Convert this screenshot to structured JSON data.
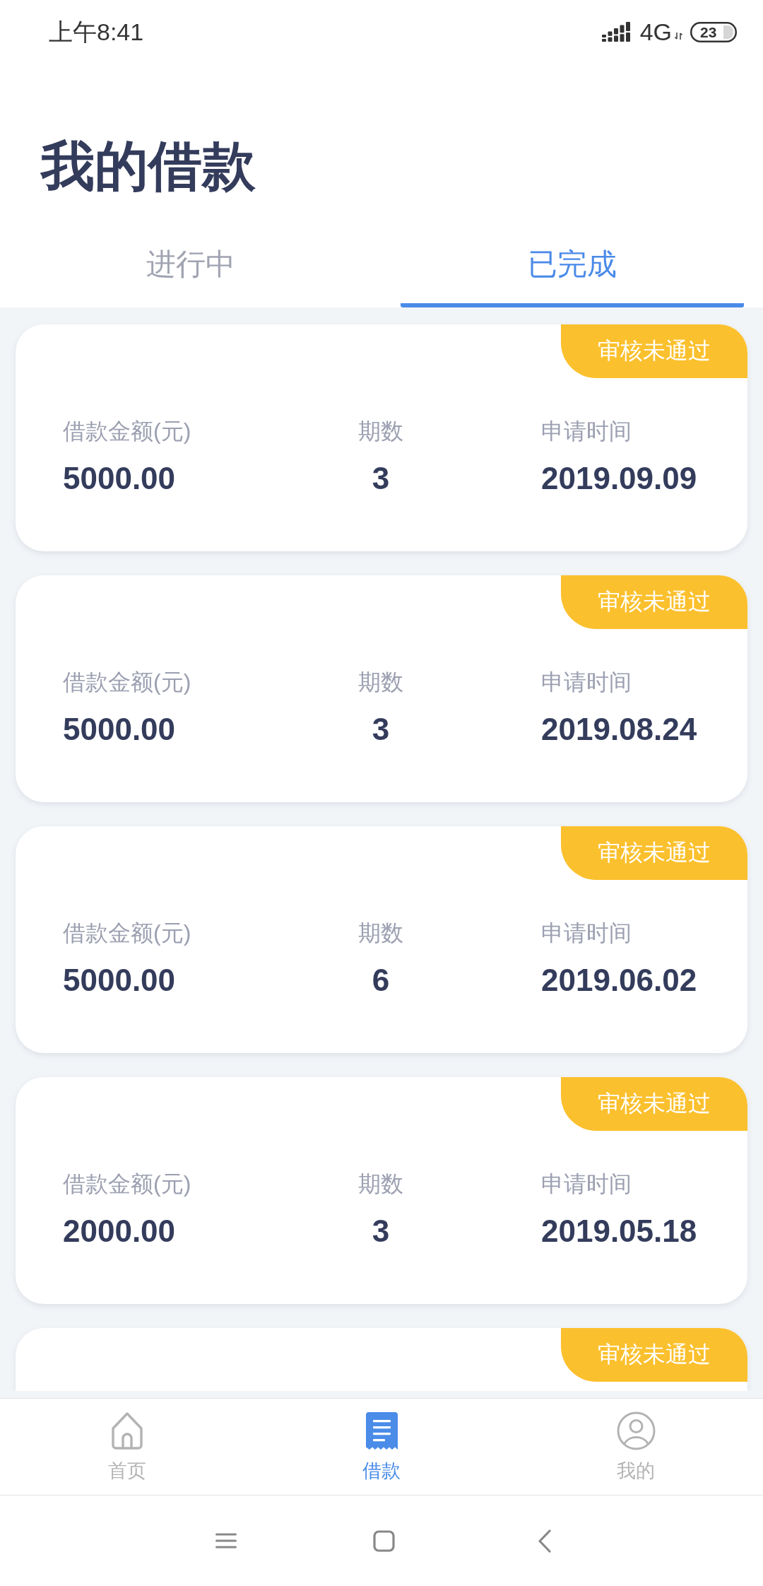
{
  "status_bar": {
    "time": "上午8:41",
    "network": "4G",
    "battery": "23"
  },
  "header": {
    "title": "我的借款"
  },
  "tabs": [
    {
      "label": "进行中",
      "selected": false
    },
    {
      "label": "已完成",
      "selected": true
    }
  ],
  "loans": [
    {
      "status": "审核未通过",
      "fields": [
        {
          "label": "借款金额(元)",
          "value": "5000.00"
        },
        {
          "label": "期数",
          "value": "3"
        },
        {
          "label": "申请时间",
          "value": "2019.09.09"
        }
      ]
    },
    {
      "status": "审核未通过",
      "fields": [
        {
          "label": "借款金额(元)",
          "value": "5000.00"
        },
        {
          "label": "期数",
          "value": "3"
        },
        {
          "label": "申请时间",
          "value": "2019.08.24"
        }
      ]
    },
    {
      "status": "审核未通过",
      "fields": [
        {
          "label": "借款金额(元)",
          "value": "5000.00"
        },
        {
          "label": "期数",
          "value": "6"
        },
        {
          "label": "申请时间",
          "value": "2019.06.02"
        }
      ]
    },
    {
      "status": "审核未通过",
      "fields": [
        {
          "label": "借款金额(元)",
          "value": "2000.00"
        },
        {
          "label": "期数",
          "value": "3"
        },
        {
          "label": "申请时间",
          "value": "2019.05.18"
        }
      ]
    },
    {
      "status": "审核未通过"
    }
  ],
  "bottom_nav": [
    {
      "label": "首页",
      "selected": false
    },
    {
      "label": "借款",
      "selected": true
    },
    {
      "label": "我的",
      "selected": false
    }
  ]
}
